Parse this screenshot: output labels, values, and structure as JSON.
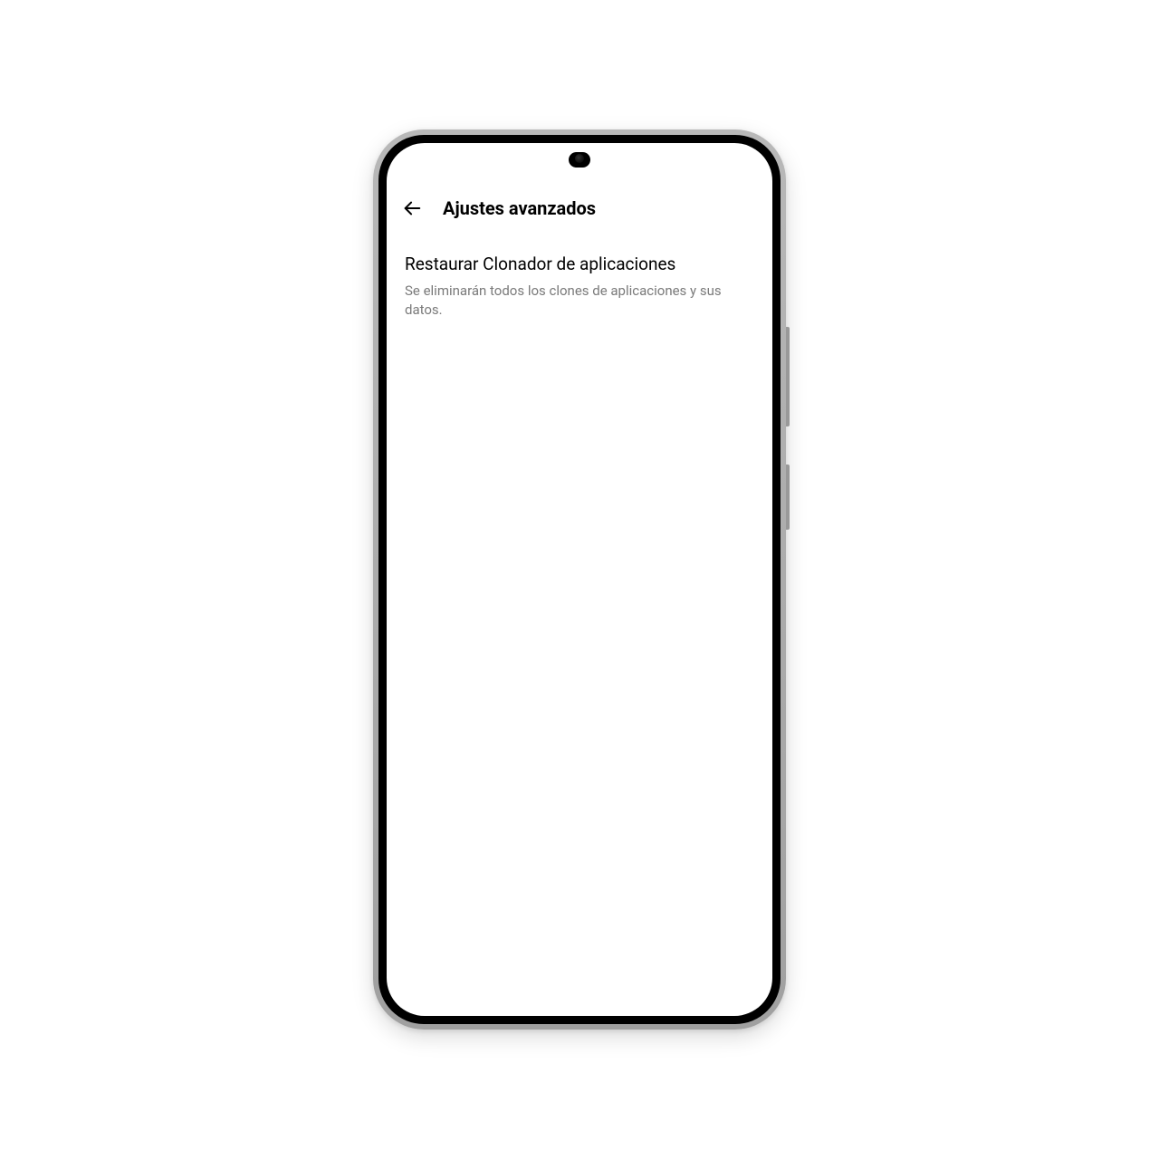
{
  "header": {
    "title": "Ajustes avanzados"
  },
  "settings": {
    "restore": {
      "title": "Restaurar Clonador de aplicaciones",
      "description": "Se eliminarán todos los clones de aplicaciones y sus datos."
    }
  }
}
